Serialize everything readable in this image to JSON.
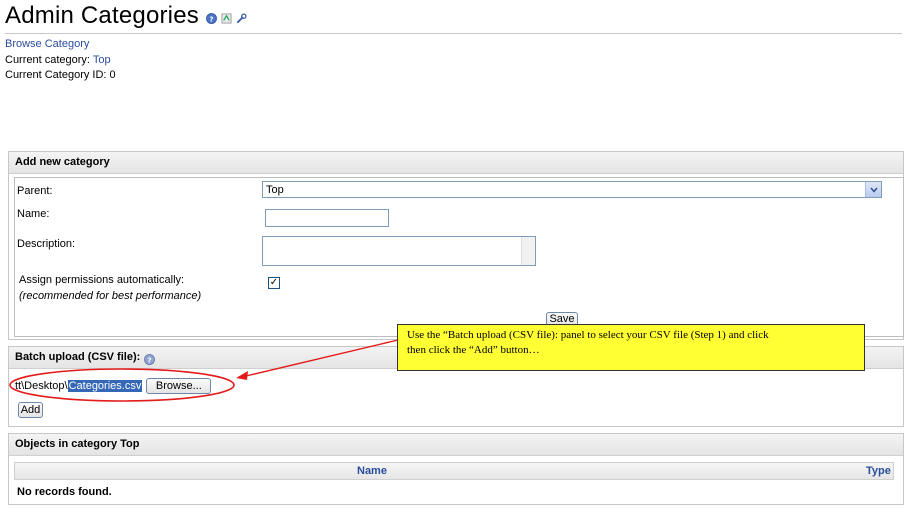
{
  "page": {
    "title": "Admin Categories",
    "title_icons": [
      "help-icon",
      "history-icon",
      "wrench-icon"
    ]
  },
  "info": {
    "browse_link": "Browse Category",
    "current_category_label": "Current category:",
    "current_category_value": "Top",
    "current_category_id_label": "Current Category ID:",
    "current_category_id_value": "0"
  },
  "add_panel": {
    "heading": "Add new category",
    "parent_label": "Parent:",
    "parent_value": "Top",
    "name_label": "Name:",
    "name_value": "",
    "description_label": "Description:",
    "description_value": "",
    "assign_label": "Assign permissions automatically:",
    "assign_note": "(recommended for best performance)",
    "assign_checked": true,
    "save_label": "Save"
  },
  "batch_panel": {
    "heading": "Batch upload (CSV file):",
    "file_path_prefix": "tt\\Desktop\\",
    "file_name": "Categories.csv",
    "browse_label": "Browse...",
    "add_label": "Add"
  },
  "objects_panel": {
    "heading": "Objects in category Top",
    "columns": [
      "Name",
      "Type"
    ],
    "empty_message": "No records found."
  },
  "callout": {
    "line1": "Use the “Batch upload (CSV file): panel to select your CSV file (Step 1) and click",
    "line2": "then click the “Add” button…"
  },
  "colors": {
    "link": "#2a4d9b",
    "callout_bg": "#ffff33",
    "annotation_red": "#e31b1b",
    "selection": "#3467b5"
  }
}
